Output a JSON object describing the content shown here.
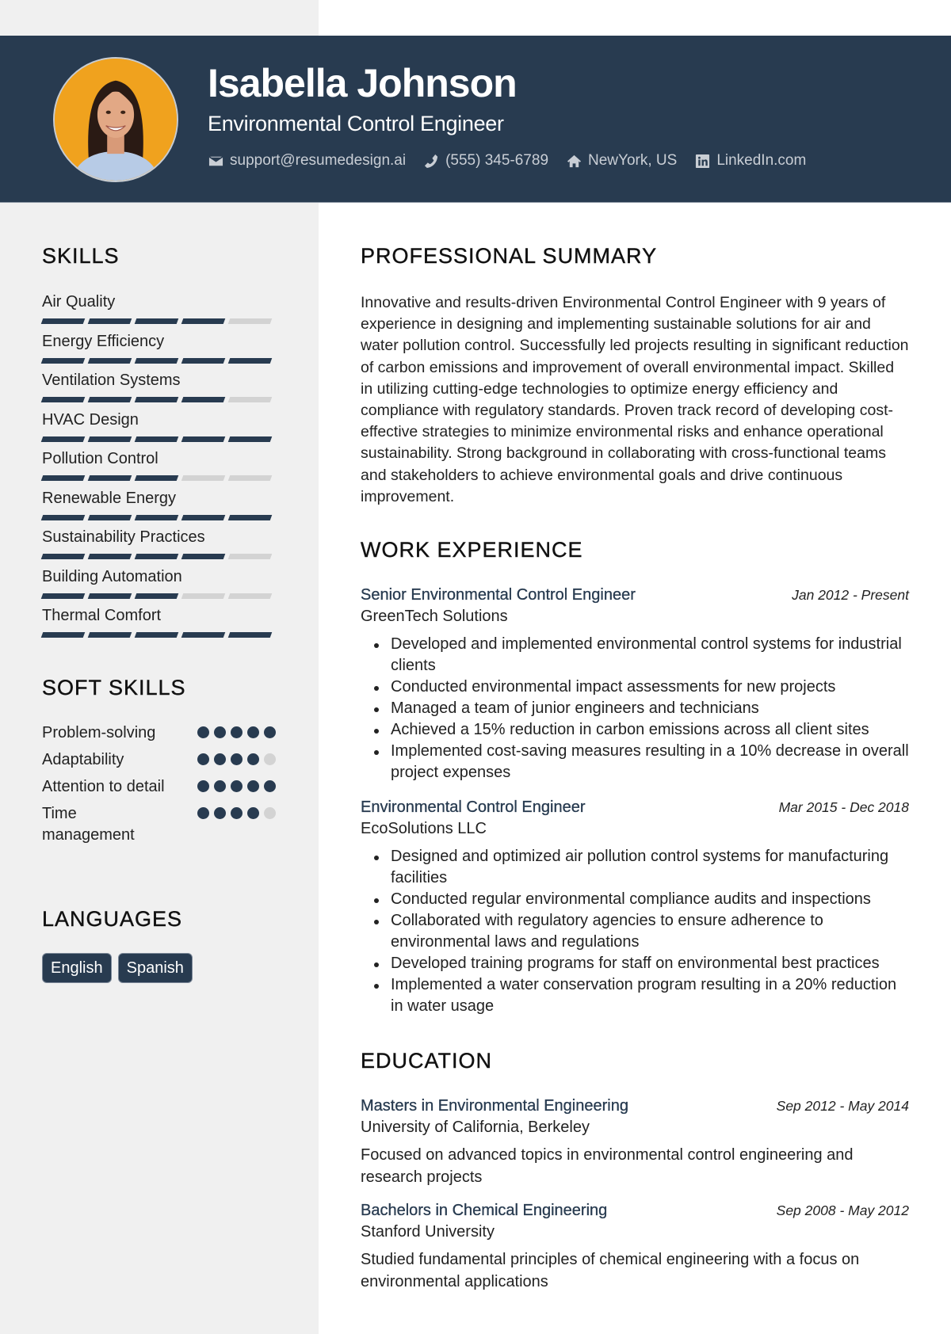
{
  "header": {
    "name": "Isabella Johnson",
    "title": "Environmental Control Engineer",
    "contacts": [
      {
        "icon": "envelope-icon",
        "text": "support@resumedesign.ai"
      },
      {
        "icon": "phone-icon",
        "text": "(555) 345-6789"
      },
      {
        "icon": "home-icon",
        "text": "NewYork, US"
      },
      {
        "icon": "linkedin-icon",
        "text": "LinkedIn.com"
      }
    ]
  },
  "colors": {
    "primary": "#283b50",
    "sidebar": "#f0f0f0",
    "inactive": "#d3d3d3"
  },
  "skills": {
    "title": "SKILLS",
    "max": 5,
    "items": [
      {
        "name": "Air Quality",
        "level": 4
      },
      {
        "name": "Energy Efficiency",
        "level": 5
      },
      {
        "name": "Ventilation Systems",
        "level": 4
      },
      {
        "name": "HVAC Design",
        "level": 5
      },
      {
        "name": "Pollution Control",
        "level": 3
      },
      {
        "name": "Renewable Energy",
        "level": 5
      },
      {
        "name": "Sustainability Practices",
        "level": 4
      },
      {
        "name": "Building Automation",
        "level": 3
      },
      {
        "name": "Thermal Comfort",
        "level": 5
      }
    ]
  },
  "soft_skills": {
    "title": "SOFT SKILLS",
    "max": 5,
    "items": [
      {
        "name": "Problem-solving",
        "level": 5
      },
      {
        "name": "Adaptability",
        "level": 4
      },
      {
        "name": "Attention to detail",
        "level": 5
      },
      {
        "name": "Time management",
        "level": 4
      }
    ]
  },
  "languages": {
    "title": "LANGUAGES",
    "items": [
      "English",
      "Spanish"
    ]
  },
  "summary": {
    "title": "PROFESSIONAL SUMMARY",
    "text": "Innovative and results-driven Environmental Control Engineer with 9 years of experience in designing and implementing sustainable solutions for air and water pollution control. Successfully led projects resulting in significant reduction of carbon emissions and improvement of overall environmental impact. Skilled in utilizing cutting-edge technologies to optimize energy efficiency and compliance with regulatory standards. Proven track record of developing cost-effective strategies to minimize environmental risks and enhance operational sustainability. Strong background in collaborating with cross-functional teams and stakeholders to achieve environmental goals and drive continuous improvement."
  },
  "work": {
    "title": "WORK EXPERIENCE",
    "jobs": [
      {
        "role": "Senior Environmental Control Engineer",
        "date": "Jan 2012 - Present",
        "org": "GreenTech Solutions",
        "bullets": [
          "Developed and implemented environmental control systems for industrial clients",
          "Conducted environmental impact assessments for new projects",
          "Managed a team of junior engineers and technicians",
          "Achieved a 15% reduction in carbon emissions across all client sites",
          "Implemented cost-saving measures resulting in a 10% decrease in overall project expenses"
        ]
      },
      {
        "role": "Environmental Control Engineer",
        "date": "Mar 2015 - Dec 2018",
        "org": "EcoSolutions LLC",
        "bullets": [
          "Designed and optimized air pollution control systems for manufacturing facilities",
          "Conducted regular environmental compliance audits and inspections",
          "Collaborated with regulatory agencies to ensure adherence to environmental laws and regulations",
          "Developed training programs for staff on environmental best practices",
          "Implemented a water conservation program resulting in a 20% reduction in water usage"
        ]
      }
    ]
  },
  "education": {
    "title": "EDUCATION",
    "items": [
      {
        "degree": "Masters in Environmental Engineering",
        "date": "Sep 2012 - May 2014",
        "school": "University of California, Berkeley",
        "desc": "Focused on advanced topics in environmental control engineering and research projects"
      },
      {
        "degree": "Bachelors in Chemical Engineering",
        "date": "Sep 2008 - May 2012",
        "school": "Stanford University",
        "desc": "Studied fundamental principles of chemical engineering with a focus on environmental applications"
      }
    ]
  }
}
